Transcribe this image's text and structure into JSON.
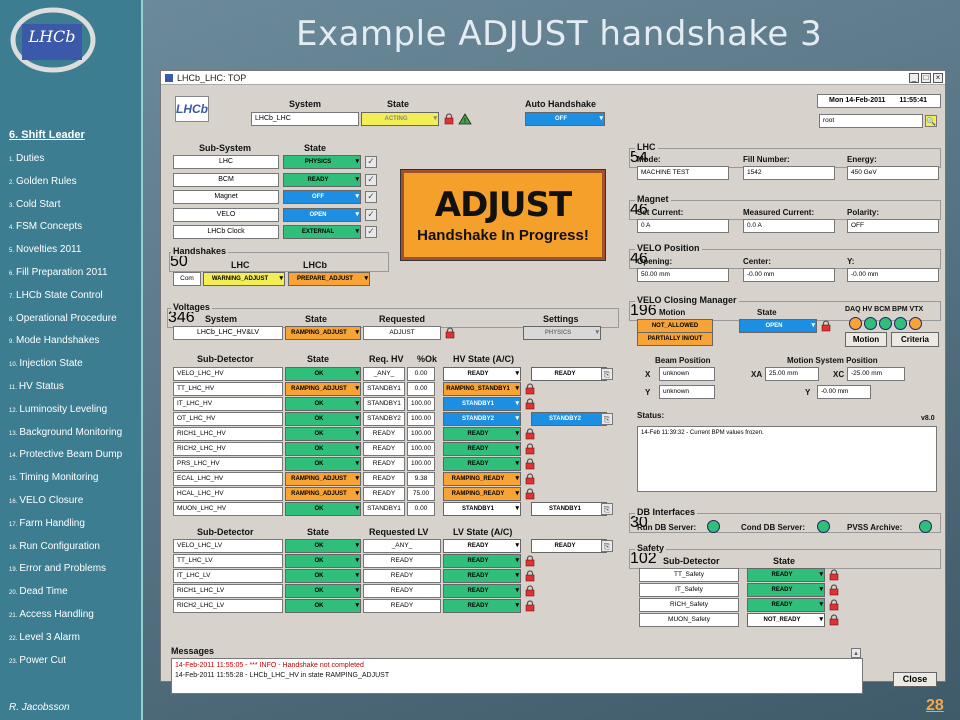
{
  "slide": {
    "title": "Example ADJUST handshake 3",
    "author": "R. Jacobsson",
    "page": "28"
  },
  "sidebar": {
    "logo": "LHCb",
    "heading": "6. Shift Leader",
    "items": [
      {
        "n": "1.",
        "t": "Duties"
      },
      {
        "n": "2.",
        "t": "Golden Rules"
      },
      {
        "n": "3.",
        "t": "Cold Start"
      },
      {
        "n": "4.",
        "t": "FSM Concepts"
      },
      {
        "n": "5.",
        "t": "Novelties 2011"
      },
      {
        "n": "6.",
        "t": "Fill Preparation 2011"
      },
      {
        "n": "7.",
        "t": "LHCb State Control"
      },
      {
        "n": "8.",
        "t": "Operational Procedure"
      },
      {
        "n": "9.",
        "t": "Mode Handshakes"
      },
      {
        "n": "10.",
        "t": "Injection State"
      },
      {
        "n": "11.",
        "t": "HV Status"
      },
      {
        "n": "12.",
        "t": "Luminosity Leveling"
      },
      {
        "n": "13.",
        "t": "Background Monitoring"
      },
      {
        "n": "14.",
        "t": "Protective Beam Dump"
      },
      {
        "n": "15.",
        "t": "Timing Monitoring"
      },
      {
        "n": "16.",
        "t": "VELO Closure"
      },
      {
        "n": "17.",
        "t": "Farm Handling"
      },
      {
        "n": "18.",
        "t": "Run Configuration"
      },
      {
        "n": "19.",
        "t": "Error and Problems"
      },
      {
        "n": "20.",
        "t": "Dead Time"
      },
      {
        "n": "21.",
        "t": "Access Handling"
      },
      {
        "n": "22.",
        "t": "Level 3 Alarm"
      },
      {
        "n": "23.",
        "t": "Power Cut"
      }
    ]
  },
  "window": {
    "title": "LHCb_LHC: TOP",
    "logo": "LHCb",
    "date": "Mon 14-Feb-2011",
    "time": "11:55:41",
    "user": "root",
    "labels": {
      "system": "System",
      "state": "State",
      "auto_handshake": "Auto Handshake",
      "subsystem": "Sub-System",
      "handshakes": "Handshakes",
      "lhc": "LHC",
      "lhcb": "LHCb",
      "com": "Com",
      "voltages": "Voltages",
      "requested": "Requested",
      "settings": "Settings",
      "subdetector": "Sub-Detector",
      "req_hv": "Req. HV",
      "pct_ok": "%Ok",
      "hv_state": "HV State (A/C)",
      "requested_lv": "Requested LV",
      "lv_state": "LV State (A/C)",
      "messages": "Messages",
      "close": "Close"
    },
    "system_name": "LHCb_LHC",
    "system_state": "ACTING",
    "auto_handshake": "OFF",
    "subsystems": [
      {
        "name": "LHC",
        "state": "PHYSICS",
        "color": "green"
      },
      {
        "name": "BCM",
        "state": "READY",
        "color": "green"
      },
      {
        "name": "Magnet",
        "state": "OFF",
        "color": "blue"
      },
      {
        "name": "VELO",
        "state": "OPEN",
        "color": "blue"
      },
      {
        "name": "LHCb Clock",
        "state": "EXTERNAL",
        "color": "green"
      }
    ],
    "handshake_lhc": "WARNING_ADJUST",
    "handshake_lhcb": "PREPARE_ADJUST",
    "banner": {
      "big": "ADJUST",
      "small": "Handshake In Progress!"
    },
    "voltages": {
      "system": "LHCb_LHC_HV&LV",
      "state": "RAMPING_ADJUST",
      "requested": "ADJUST",
      "settings": "PHYSICS"
    },
    "hv_rows": [
      {
        "name": "VELO_LHC_HV",
        "state": "OK",
        "sc": "green",
        "req": "_ANY_",
        "pct": "0.00",
        "a": "READY",
        "ac": "white",
        "b": "READY",
        "bc": "white"
      },
      {
        "name": "TT_LHC_HV",
        "state": "RAMPING_ADJUST",
        "sc": "orange",
        "req": "STANDBY1",
        "pct": "0.00",
        "a": "RAMPING_STANDBY1",
        "ac": "orange",
        "b": "",
        "bc": ""
      },
      {
        "name": "IT_LHC_HV",
        "state": "OK",
        "sc": "green",
        "req": "STANDBY1",
        "pct": "100.00",
        "a": "STANDBY1",
        "ac": "blue",
        "b": "",
        "bc": ""
      },
      {
        "name": "OT_LHC_HV",
        "state": "OK",
        "sc": "green",
        "req": "STANDBY2",
        "pct": "100.00",
        "a": "STANDBY2",
        "ac": "blue",
        "b": "STANDBY2",
        "bc": "blue"
      },
      {
        "name": "RICH1_LHC_HV",
        "state": "OK",
        "sc": "green",
        "req": "READY",
        "pct": "100.00",
        "a": "READY",
        "ac": "green",
        "b": "",
        "bc": ""
      },
      {
        "name": "RICH2_LHC_HV",
        "state": "OK",
        "sc": "green",
        "req": "READY",
        "pct": "100.00",
        "a": "READY",
        "ac": "green",
        "b": "",
        "bc": ""
      },
      {
        "name": "PRS_LHC_HV",
        "state": "OK",
        "sc": "green",
        "req": "READY",
        "pct": "100.00",
        "a": "READY",
        "ac": "green",
        "b": "",
        "bc": ""
      },
      {
        "name": "ECAL_LHC_HV",
        "state": "RAMPING_ADJUST",
        "sc": "orange",
        "req": "READY",
        "pct": "9.38",
        "a": "RAMPING_READY",
        "ac": "orange",
        "b": "",
        "bc": ""
      },
      {
        "name": "HCAL_LHC_HV",
        "state": "RAMPING_ADJUST",
        "sc": "orange",
        "req": "READY",
        "pct": "75.00",
        "a": "RAMPING_READY",
        "ac": "orange",
        "b": "",
        "bc": ""
      },
      {
        "name": "MUON_LHC_HV",
        "state": "OK",
        "sc": "green",
        "req": "STANDBY1",
        "pct": "0.00",
        "a": "STANDBY1",
        "ac": "white",
        "b": "STANDBY1",
        "bc": "white"
      }
    ],
    "lv_rows": [
      {
        "name": "VELO_LHC_LV",
        "state": "OK",
        "req": "_ANY_",
        "a": "READY",
        "ac": "white",
        "b": "READY",
        "bc": "white"
      },
      {
        "name": "TT_LHC_LV",
        "state": "OK",
        "req": "READY",
        "a": "READY",
        "ac": "green",
        "b": "",
        "bc": ""
      },
      {
        "name": "IT_LHC_LV",
        "state": "OK",
        "req": "READY",
        "a": "READY",
        "ac": "green",
        "b": "",
        "bc": ""
      },
      {
        "name": "RICH1_LHC_LV",
        "state": "OK",
        "req": "READY",
        "a": "READY",
        "ac": "green",
        "b": "",
        "bc": ""
      },
      {
        "name": "RICH2_LHC_LV",
        "state": "OK",
        "req": "READY",
        "a": "READY",
        "ac": "green",
        "b": "",
        "bc": ""
      }
    ],
    "lhc": {
      "label": "LHC",
      "mode_l": "Mode:",
      "mode": "MACHINE TEST",
      "fill_l": "Fill Number:",
      "fill": "1542",
      "energy_l": "Energy:",
      "energy": "450 GeV"
    },
    "magnet": {
      "label": "Magnet",
      "set_l": "Set Current:",
      "set": "0 A",
      "meas_l": "Measured Current:",
      "meas": "0.0 A",
      "pol_l": "Polarity:",
      "pol": "OFF"
    },
    "velo": {
      "label": "VELO Position",
      "open_l": "Opening:",
      "open": "50.00 mm",
      "center_l": "Center:",
      "center": "-0.00 mm",
      "y_l": "Y:",
      "y": "-0.00 mm"
    },
    "velo_cm": {
      "label": "VELO Closing Manager",
      "motion": "Motion",
      "state": "State",
      "m1": "NOT_ALLOWED",
      "m2": "PARTIALLY IN/OUT",
      "st": "OPEN",
      "dots": "DAQ HV BCM BPM VTX",
      "b_motion": "Motion",
      "b_criteria": "Criteria",
      "beam_pos": "Beam Position",
      "mss": "Motion System Position",
      "x_l": "X",
      "x": "unknown",
      "y_l": "Y",
      "y": "unknown",
      "xa_l": "XA",
      "xa": "25.00 mm",
      "xc_l": "XC",
      "xc": "-25.00 mm",
      "yy_l": "Y",
      "yy": "-0.00 mm",
      "status_l": "Status:",
      "ver": "v8.0",
      "status": "14-Feb 11:39:32 - Current BPM values frozen."
    },
    "db": {
      "label": "DB Interfaces",
      "run": "Run DB Server:",
      "cond": "Cond DB Server:",
      "pvss": "PVSS Archive:"
    },
    "safety": {
      "label": "Safety",
      "sd": "Sub-Detector",
      "st": "State",
      "rows": [
        {
          "n": "TT_Safety",
          "s": "READY",
          "c": "green"
        },
        {
          "n": "IT_Safety",
          "s": "READY",
          "c": "green"
        },
        {
          "n": "RICH_Safety",
          "s": "READY",
          "c": "green"
        },
        {
          "n": "MUON_Safety",
          "s": "NOT_READY",
          "c": "white"
        }
      ]
    },
    "messages": [
      "14-Feb-2011 11:55:05 - *** INFO - Handshake not completed",
      "14-Feb-2011 11:55:28 - LHCb_LHC_HV in state RAMPING_ADJUST"
    ]
  }
}
